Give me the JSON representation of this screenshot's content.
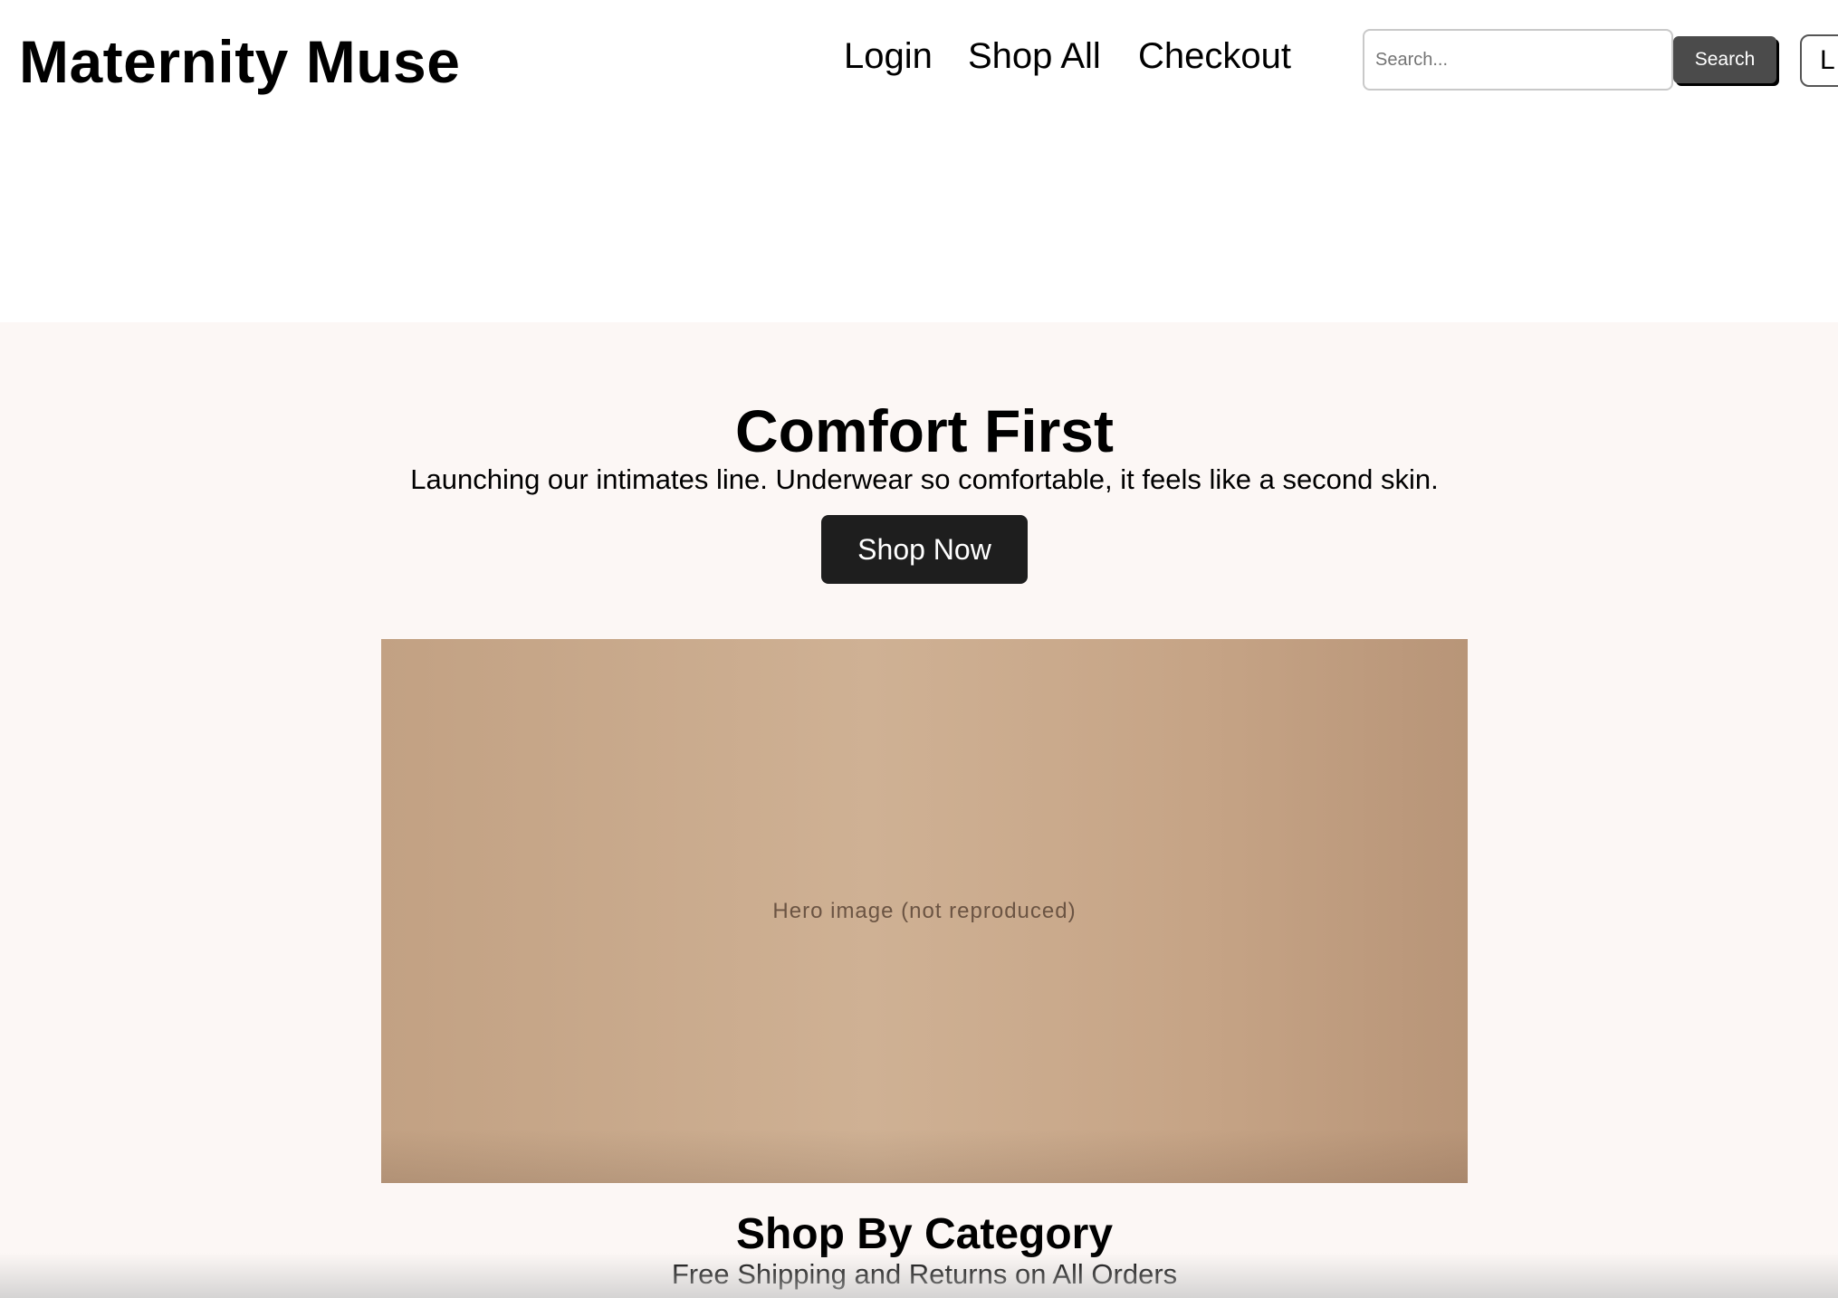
{
  "header": {
    "logo": "Maternity Muse",
    "nav": {
      "login": "Login",
      "shop_all": "Shop All",
      "checkout": "Checkout"
    },
    "search": {
      "placeholder": "Search...",
      "value": "",
      "button_label": "Search"
    },
    "edge_button_label": "L"
  },
  "hero": {
    "title": "Comfort First",
    "subtitle": "Launching our intimates line. Underwear so comfortable, it feels like a second skin.",
    "cta_label": "Shop Now",
    "image_alt": "Hero image (not reproduced)"
  },
  "category": {
    "title": "Shop By Category",
    "subtitle": "Free Shipping and Returns on All Orders",
    "extra": ""
  },
  "colors": {
    "hero_background": "#fcf7f5",
    "search_button": "#4b4b4b",
    "cta_button": "#1e1e1e",
    "image_placeholder": "#c8a88b"
  }
}
